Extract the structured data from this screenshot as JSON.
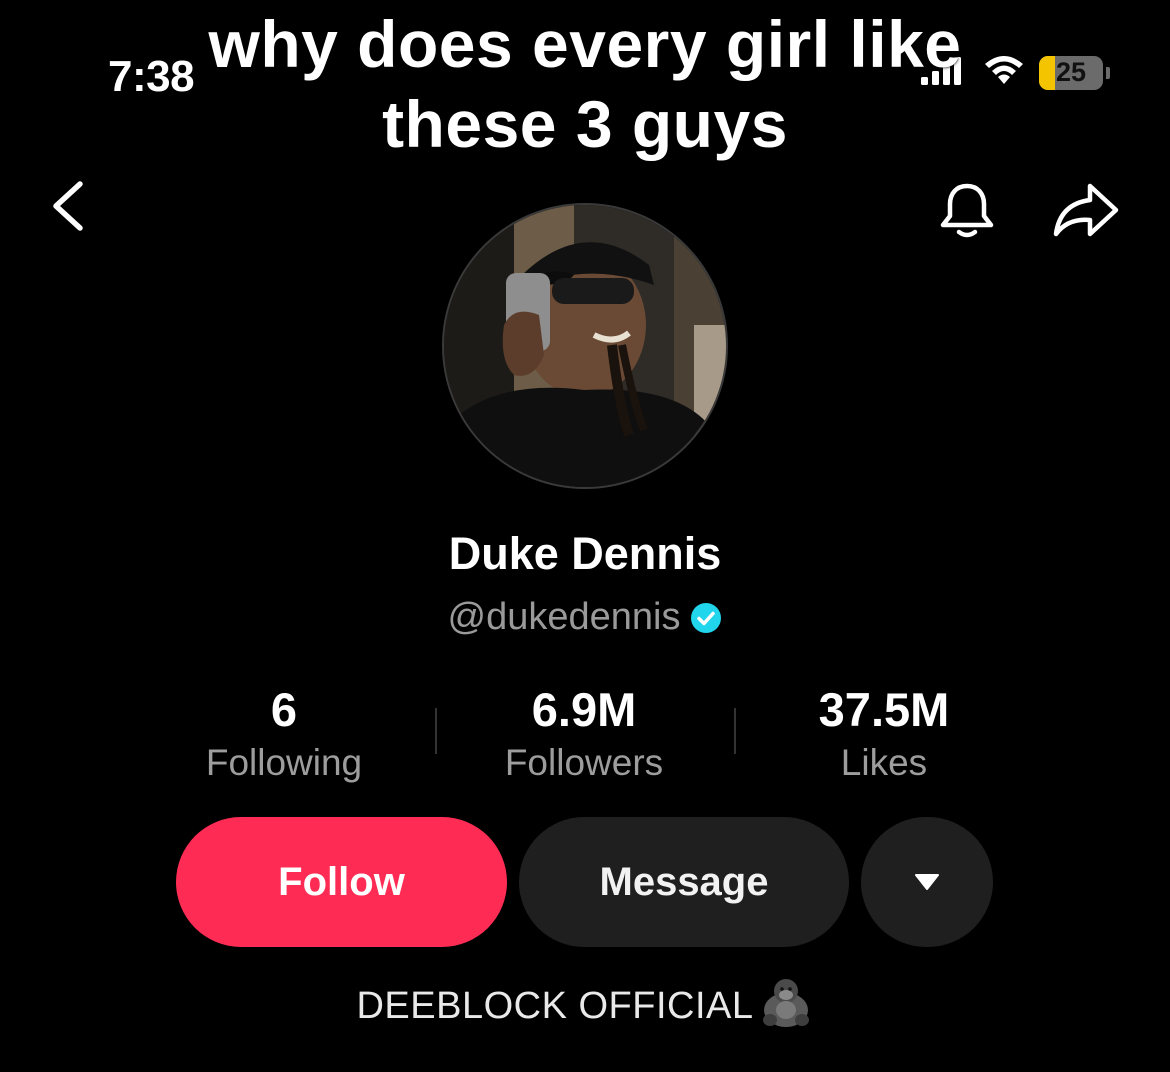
{
  "status_bar": {
    "time": "7:38",
    "battery_level": "25",
    "battery_fraction": 0.25,
    "icons": [
      "signal-icon",
      "wifi-icon",
      "battery-icon"
    ],
    "battery_color": "#f5c400"
  },
  "overlay_caption": {
    "line1": "why does every girl like",
    "line2": "these 3 guys"
  },
  "header": {
    "icons": [
      "back-chevron-icon",
      "bell-icon",
      "share-icon"
    ]
  },
  "profile": {
    "name": "Duke Dennis",
    "handle": "@dukedennis",
    "verified": true,
    "verified_color": "#20d5ec",
    "avatar_icon": "avatar-photo"
  },
  "stats": [
    {
      "value": "6",
      "label": "Following"
    },
    {
      "value": "6.9M",
      "label": "Followers"
    },
    {
      "value": "37.5M",
      "label": "Likes"
    }
  ],
  "actions": {
    "follow_label": "Follow",
    "message_label": "Message",
    "more_icon": "dropdown-caret-icon",
    "follow_color": "#fe2c55"
  },
  "bio": {
    "text": "DEEBLOCK OFFICIAL",
    "emoji_icon": "gorilla-icon"
  }
}
